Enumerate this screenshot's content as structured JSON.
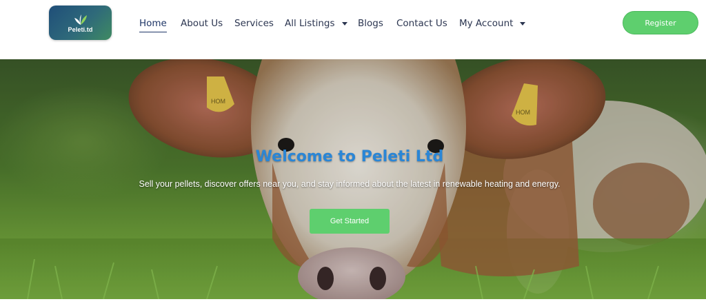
{
  "header": {
    "logo_text": "Peleti.td",
    "nav": [
      {
        "label": "Home",
        "active": true
      },
      {
        "label": "About Us"
      },
      {
        "label": "Services"
      },
      {
        "label": "All Listings",
        "has_dropdown": true
      },
      {
        "label": "Blogs"
      },
      {
        "label": "Contact Us"
      },
      {
        "label": "My Account",
        "has_dropdown": true
      }
    ],
    "register_label": "Register"
  },
  "hero": {
    "title": "Welcome to Peleti Ltd",
    "subtitle": "Sell your pellets, discover offers near you, and stay informed about the latest in renewable heating and energy.",
    "cta_label": "Get Started",
    "ear_tag_left": "HOM",
    "ear_tag_right": "HOM"
  },
  "colors": {
    "accent_green": "#5ecf6e",
    "title_blue": "#2a86d6",
    "nav_text": "#2b3550"
  }
}
